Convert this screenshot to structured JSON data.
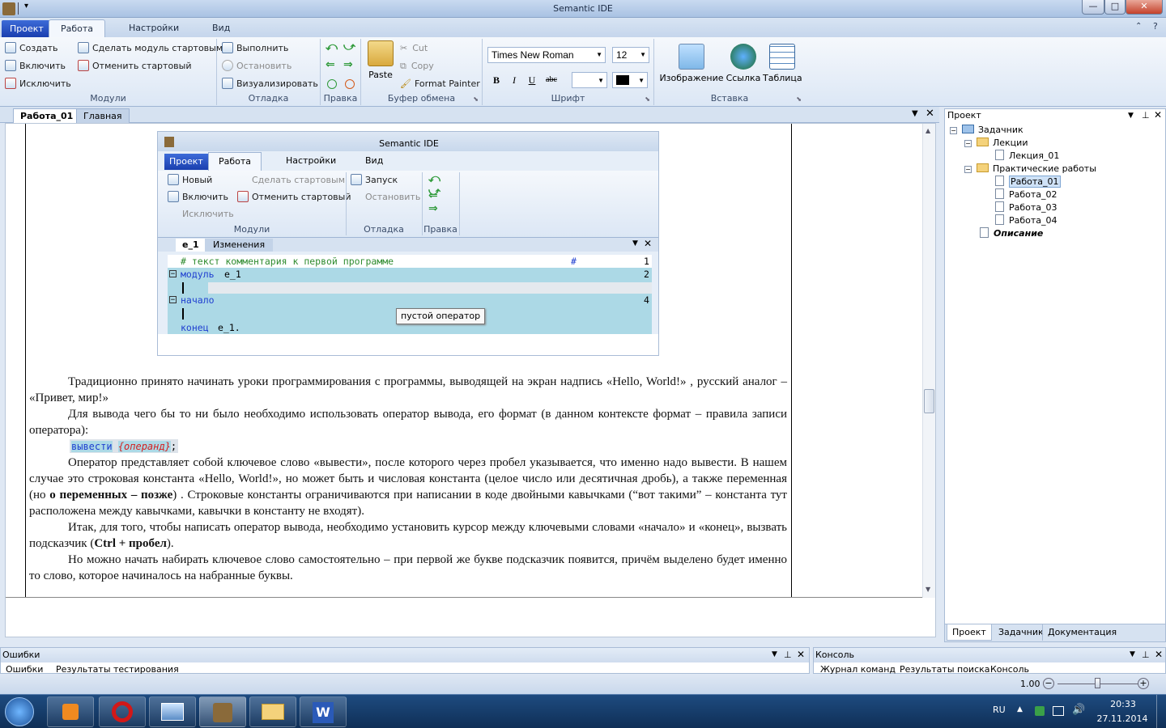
{
  "window": {
    "title": "Semantic IDE",
    "controls": {
      "minimize": "—",
      "maximize": "□",
      "close": "✕"
    }
  },
  "ribbon_tabs": [
    "Проект",
    "Работа",
    "Настройки",
    "Вид"
  ],
  "ribbon": {
    "modules": {
      "label": "Модули",
      "create": "Создать",
      "include": "Включить",
      "exclude": "Исключить",
      "make_start": "Сделать модуль стартовым",
      "cancel_start": "Отменить стартовый"
    },
    "debug": {
      "label": "Отладка",
      "run": "Выполнить",
      "stop": "Остановить",
      "visualize": "Визуализировать"
    },
    "edit": {
      "label": "Правка"
    },
    "clipboard": {
      "label": "Буфер обмена",
      "paste": "Paste",
      "cut": "Cut",
      "copy": "Copy",
      "format_painter": "Format Painter"
    },
    "font": {
      "label": "Шрифт",
      "family": "Times New Roman",
      "size": "12",
      "bold": "B",
      "italic": "I",
      "underline": "U",
      "strike": "abc"
    },
    "insert": {
      "label": "Вставка",
      "image": "Изображение",
      "link": "Ссылка",
      "table": "Таблица"
    }
  },
  "doc_tabs": [
    "Работа_01",
    "Главная"
  ],
  "embedded": {
    "title": "Semantic IDE",
    "tabs": [
      "Проект",
      "Работа",
      "Настройки",
      "Вид"
    ],
    "modules": {
      "label": "Модули",
      "new": "Новый",
      "include": "Включить",
      "exclude": "Исключить",
      "make_start": "Сделать стартовым",
      "cancel_start": "Отменить стартовый"
    },
    "debug": {
      "label": "Отладка",
      "run": "Запуск",
      "stop": "Остановить"
    },
    "edit": {
      "label": "Правка"
    },
    "doc_tabs": [
      "e_1",
      "Изменения"
    ],
    "code": {
      "l1": "# текст комментария к первой программе",
      "l1_hash": "#",
      "n1": "1",
      "l2_kw": "модуль",
      "l2_id": "e_1",
      "n2": "2",
      "l4_kw": "начало",
      "n4": "4",
      "l6_kw": "конец",
      "l6_id": "e_1."
    },
    "tooltip": "пустой оператор"
  },
  "text": {
    "p1": "Традиционно принято начинать уроки программирования с программы, выводящей на экран надпись «Hello, World!» , русский аналог – «Привет, мир!»",
    "p2": "Для вывода чего бы то ни было необходимо использовать оператор вывода, его формат (в данном контексте формат – правила записи оператора):",
    "code_kw": "вывести",
    "code_op": "{операнд}",
    "code_end": ";",
    "p3a": "Оператор представляет собой ключевое слово «вывести», после которого через пробел указывается, что именно надо вывести. В нашем случае это строковая константа «Hello, World!», но может быть и числовая константа (целое число или десятичная дробь), а также переменная (но ",
    "p3b": "о переменных – позже",
    "p3c": ") . Строковые константы ограничиваются при написании в коде двойными кавычками (“вот такими” – константа тут расположена между кавычками, кавычки в константу не входят).",
    "p4a": "Итак, для того, чтобы написать оператор вывода, необходимо установить курсор между ключевыми словами «начало» и «конец», вызвать подсказчик (",
    "p4b": "Ctrl + пробел",
    "p4c": ").",
    "p5": "Но можно начать набирать ключевое слово самостоятельно – при первой же букве подсказчик появится, причём выделено будет именно то слово, которое начиналось на набранные буквы."
  },
  "project_panel": {
    "title": "Проект",
    "tree": {
      "root": "Задачник",
      "lectures": "Лекции",
      "lecture1": "Лекция_01",
      "practice": "Практические работы",
      "w1": "Работа_01",
      "w2": "Работа_02",
      "w3": "Работа_03",
      "w4": "Работа_04",
      "desc": "Описание"
    },
    "tabs": [
      "Проект",
      "Задачник",
      "Документация"
    ]
  },
  "bottom": {
    "errors": {
      "title": "Ошибки",
      "tabs": [
        "Ошибки",
        "Результаты тестирования"
      ]
    },
    "console": {
      "title": "Консоль",
      "tabs": [
        "Журнал команд",
        "Результаты поиска",
        "Консоль"
      ]
    }
  },
  "status": {
    "zoom": "1.00",
    "zoom_fraction": 0.5
  },
  "taskbar": {
    "lang": "RU",
    "time": "20:33",
    "date": "27.11.2014"
  },
  "colors": {
    "accent": "#1a3faf",
    "code_bg": "#acd9e6",
    "keyword": "#1f3fd0"
  }
}
